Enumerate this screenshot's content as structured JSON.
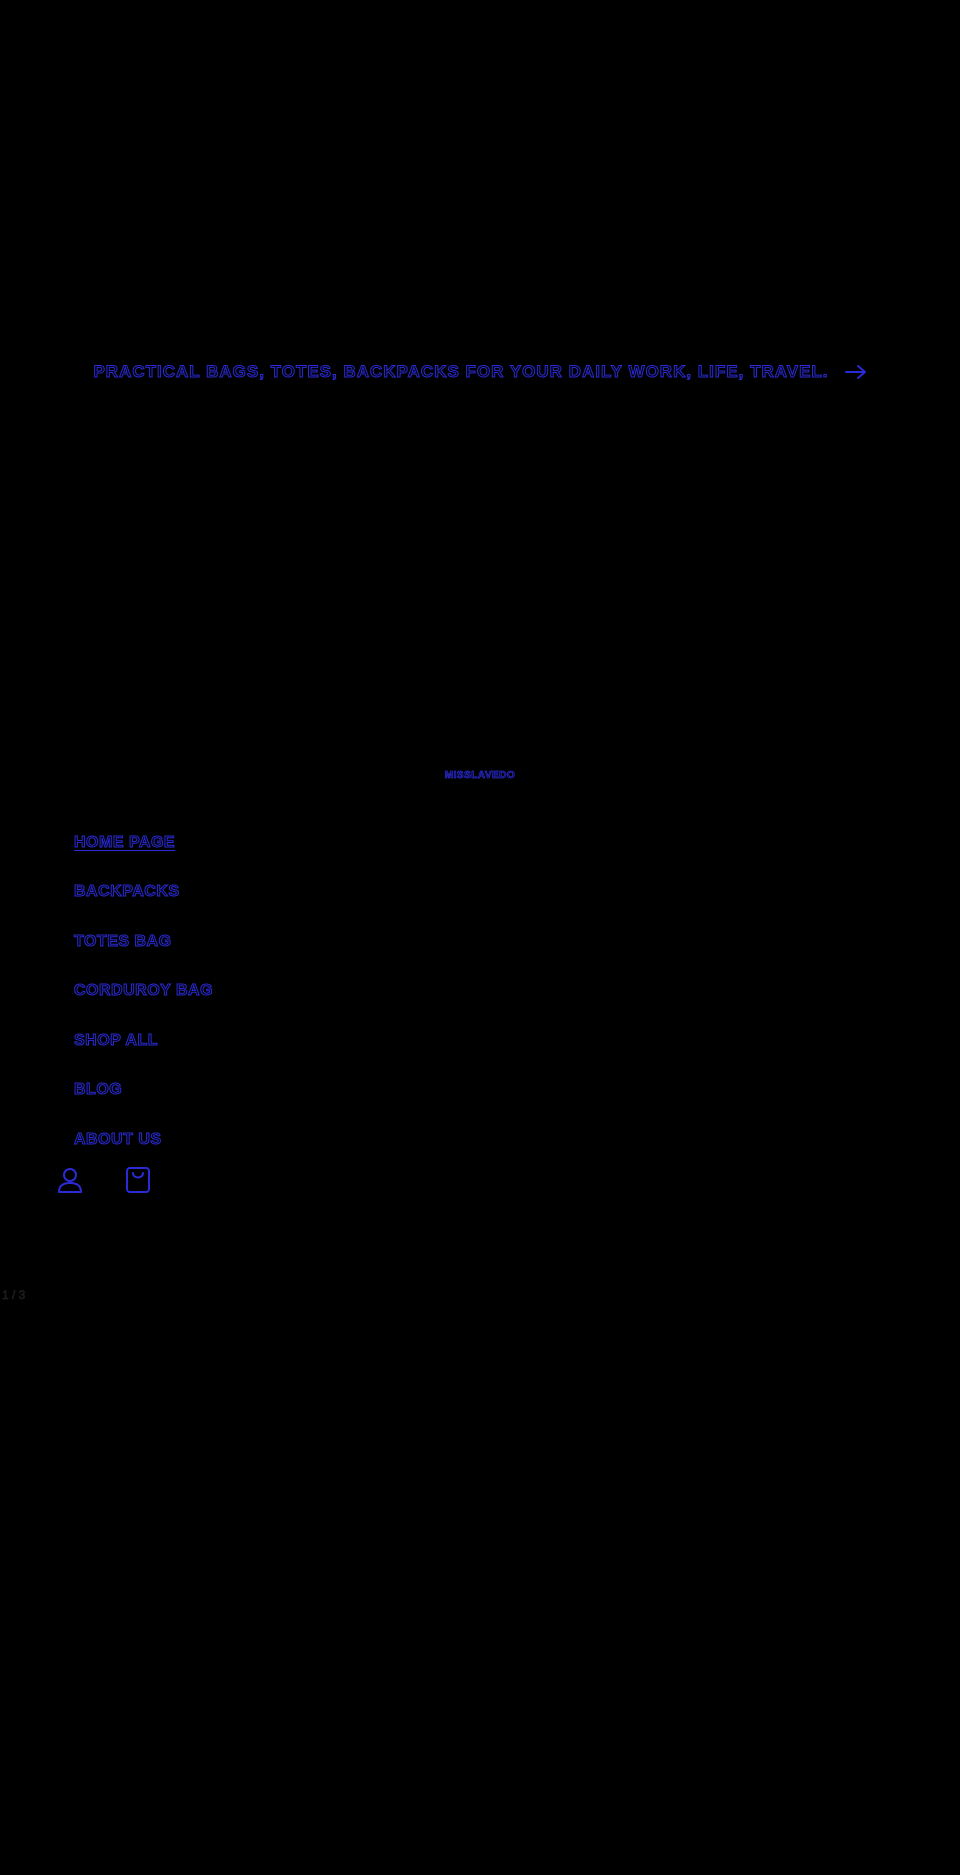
{
  "colors": {
    "background": "#000000",
    "outline_text": "#2a2ad6"
  },
  "announcement": {
    "text": "PRACTICAL BAGS, TOTES, BACKPACKS FOR YOUR DAILY WORK, LIFE, TRAVEL.",
    "icon": "arrow-right-icon"
  },
  "logo": {
    "text": "MISSLAVEDO"
  },
  "menu": {
    "items": [
      {
        "label": "HOME PAGE"
      },
      {
        "label": "BACKPACKS"
      },
      {
        "label": "TOTES BAG"
      },
      {
        "label": "CORDUROY BAG"
      },
      {
        "label": "SHOP ALL"
      },
      {
        "label": "BLOG"
      },
      {
        "label": "ABOUT US"
      }
    ]
  },
  "header_icons": {
    "account": "account-icon",
    "cart": "cart-icon"
  },
  "slideshow": {
    "counter": "1 / 3"
  }
}
